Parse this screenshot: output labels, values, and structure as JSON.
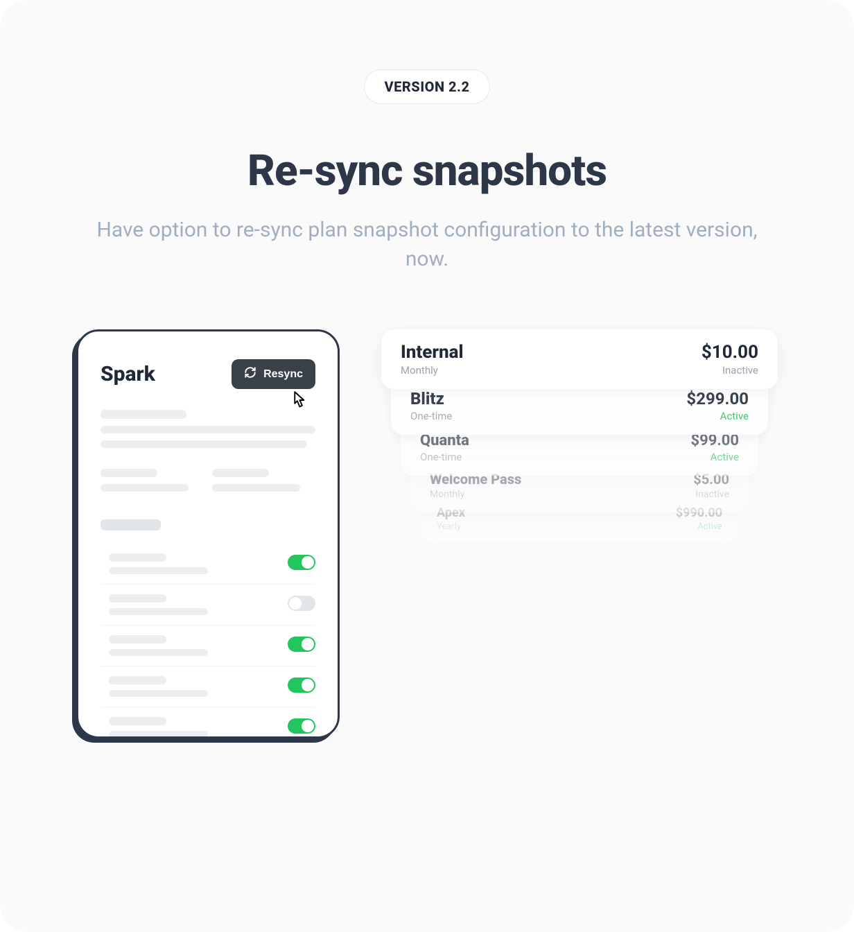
{
  "header": {
    "badge": "VERSION 2.2",
    "title": "Re-sync snapshots",
    "subtitle": "Have option to re-sync plan snapshot configuration to the latest version, now."
  },
  "device": {
    "title": "Spark",
    "resync_label": "Resync",
    "features": [
      {
        "on": true
      },
      {
        "on": false
      },
      {
        "on": true
      },
      {
        "on": true
      },
      {
        "on": true
      },
      {
        "on": false
      }
    ]
  },
  "plans": [
    {
      "name": "Internal",
      "period": "Monthly",
      "price": "$10.00",
      "status": "Inactive",
      "status_class": "inactive"
    },
    {
      "name": "Blitz",
      "period": "One-time",
      "price": "$299.00",
      "status": "Active",
      "status_class": "active"
    },
    {
      "name": "Quanta",
      "period": "One-time",
      "price": "$99.00",
      "status": "Active",
      "status_class": "active"
    },
    {
      "name": "Welcome Pass",
      "period": "Monthly",
      "price": "$5.00",
      "status": "Inactive",
      "status_class": "inactive"
    },
    {
      "name": "Apex",
      "period": "Yearly",
      "price": "$990.00",
      "status": "Active",
      "status_class": "active"
    }
  ]
}
